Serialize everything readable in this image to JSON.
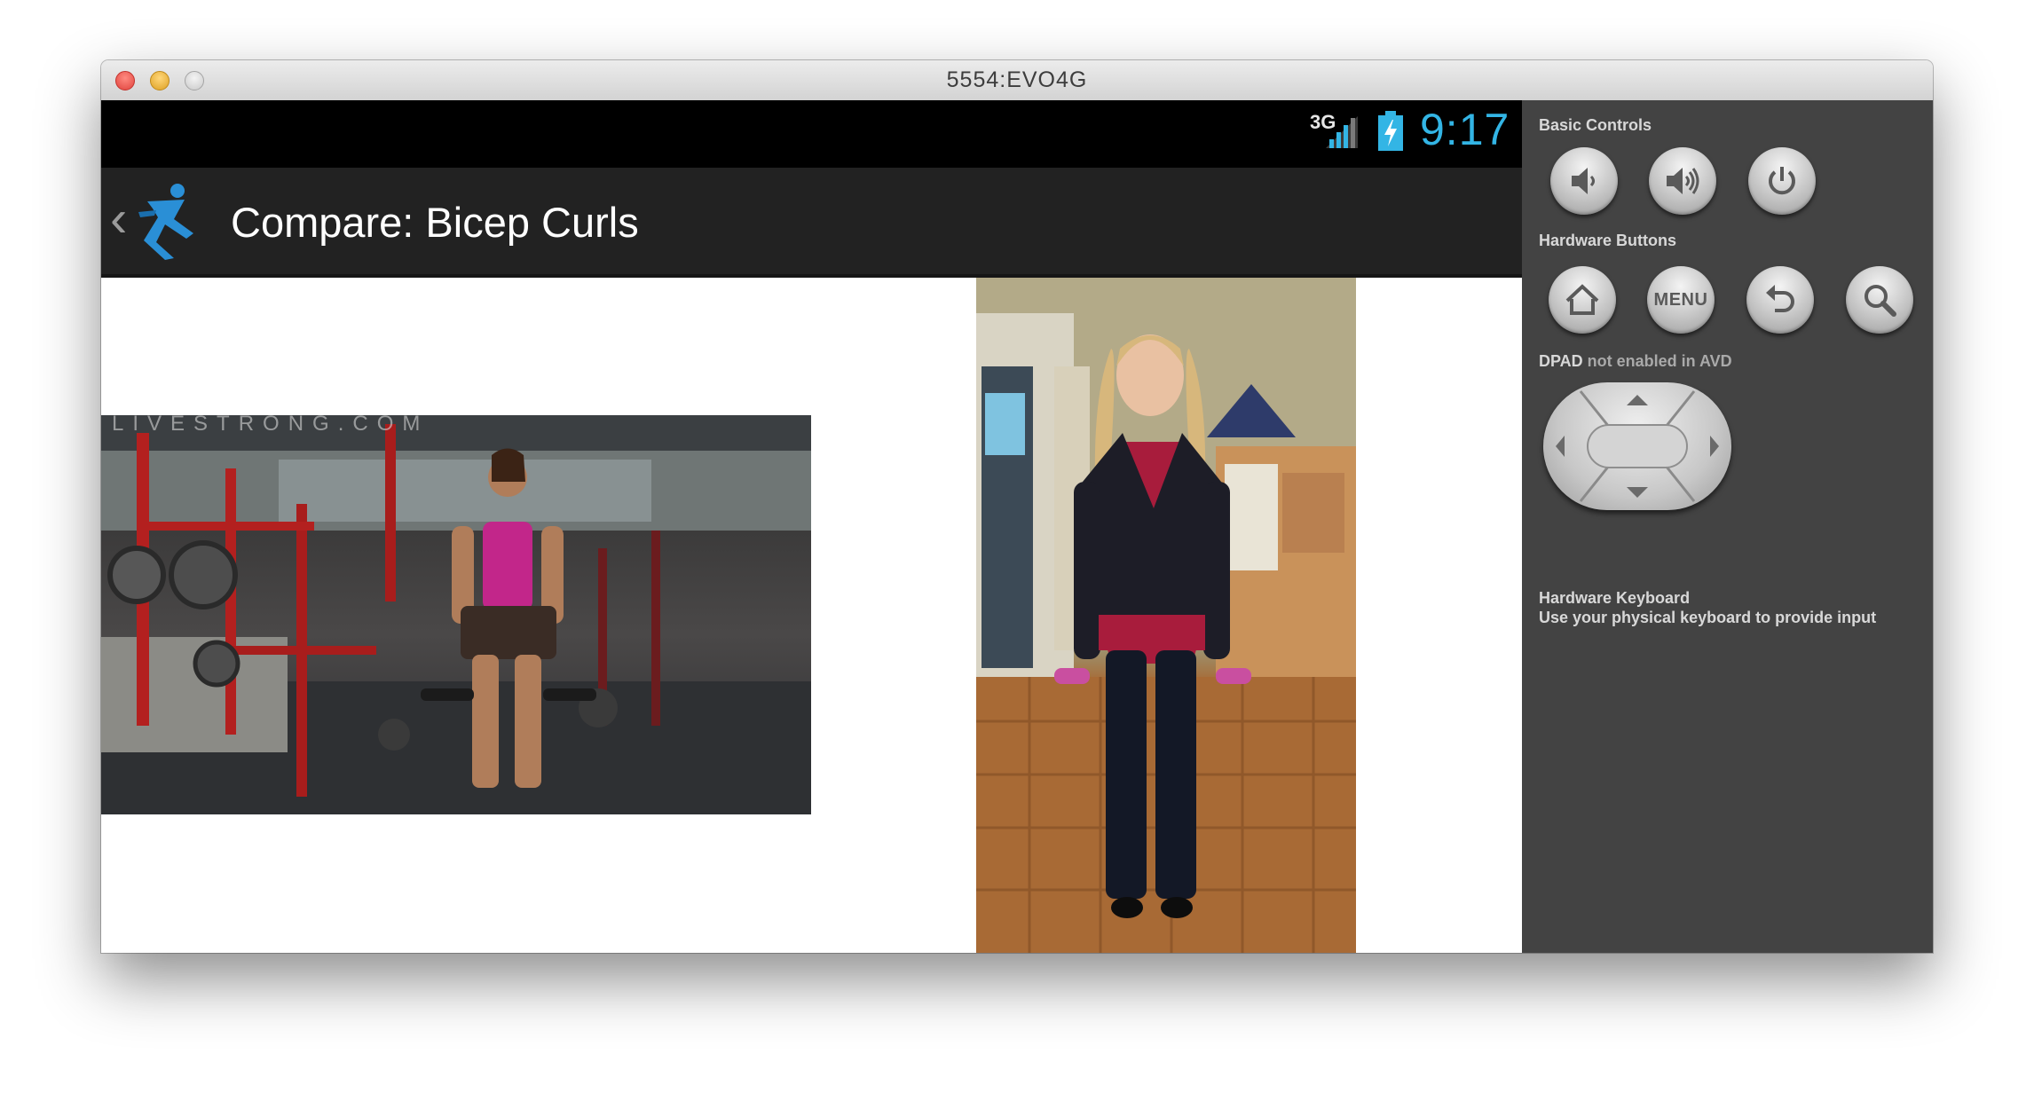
{
  "window": {
    "title": "5554:EVO4G"
  },
  "statusbar": {
    "network": "3G",
    "time": "9:17"
  },
  "actionbar": {
    "title": "Compare: Bicep Curls"
  },
  "media": {
    "left_video_watermark": "LIVESTRONG.COM"
  },
  "panel": {
    "basic_controls_label": "Basic Controls",
    "hardware_buttons_label": "Hardware Buttons",
    "menu_button_label": "MENU",
    "dpad_label_strong": "DPAD",
    "dpad_label_rest": " not enabled in AVD",
    "keyboard_title": "Hardware Keyboard",
    "keyboard_desc": "Use your physical keyboard to provide input"
  },
  "colors": {
    "clock": "#33b5e5",
    "panel_bg": "#434343",
    "actionbar_bg": "#222222"
  }
}
